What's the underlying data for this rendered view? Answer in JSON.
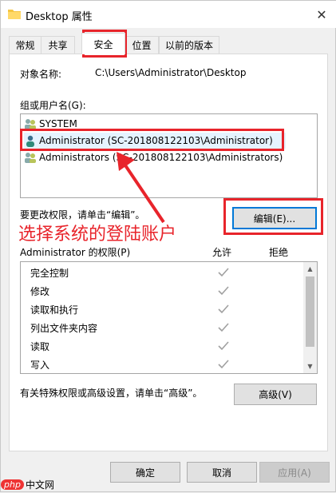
{
  "window": {
    "title": "Desktop 属性",
    "close_label": "✕"
  },
  "tabs": [
    {
      "label": "常规"
    },
    {
      "label": "共享"
    },
    {
      "label": "安全"
    },
    {
      "label": "位置"
    },
    {
      "label": "以前的版本"
    }
  ],
  "security": {
    "object_name_label": "对象名称:",
    "object_name_value": "C:\\Users\\Administrator\\Desktop",
    "group_label": "组或用户名(G):",
    "users": [
      {
        "name": "SYSTEM"
      },
      {
        "name": "Administrator (SC-201808122103\\Administrator)"
      },
      {
        "name": "Administrators (SC-201808122103\\Administrators)"
      }
    ],
    "edit_hint": "要更改权限，请单击“编辑”。",
    "edit_button": "编辑(E)...",
    "perm_header_label": "Administrator 的权限(P)",
    "allow_label": "允许",
    "deny_label": "拒绝",
    "permissions": [
      {
        "name": "完全控制",
        "allow": true
      },
      {
        "name": "修改",
        "allow": true
      },
      {
        "name": "读取和执行",
        "allow": true
      },
      {
        "name": "列出文件夹内容",
        "allow": true
      },
      {
        "name": "读取",
        "allow": true
      },
      {
        "name": "写入",
        "allow": true
      }
    ],
    "advanced_hint": "有关特殊权限或高级设置，请单击“高级”。",
    "advanced_button": "高级(V)"
  },
  "footer": {
    "ok": "确定",
    "cancel": "取消",
    "apply": "应用(A)"
  },
  "annotation": {
    "text": "选择系统的登陆账户",
    "color": "#e8242b"
  },
  "watermark": {
    "badge": "php",
    "text": "中文网"
  }
}
